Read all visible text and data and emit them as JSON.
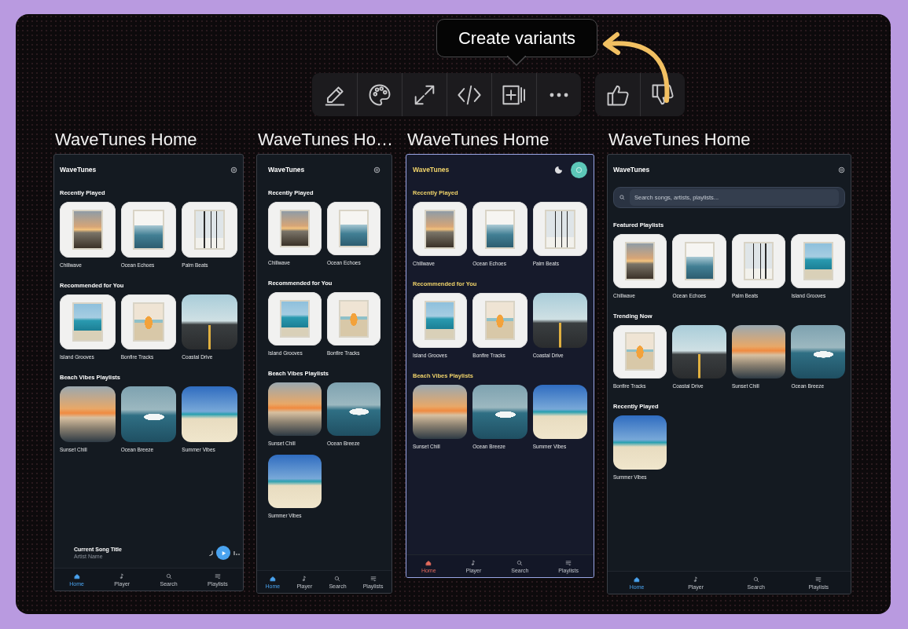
{
  "toolbar": {
    "tooltip": "Create variants",
    "tools": [
      {
        "kind": "edit"
      },
      {
        "kind": "palette"
      },
      {
        "kind": "expand"
      },
      {
        "kind": "code"
      },
      {
        "kind": "add-variant"
      },
      {
        "kind": "more"
      }
    ],
    "feedback": [
      {
        "kind": "like"
      },
      {
        "kind": "dislike"
      }
    ]
  },
  "variants": [
    {
      "title": "WaveTunes Home",
      "selected": false,
      "kind": "default",
      "app_name": "WaveTunes",
      "header_actions": [
        {
          "kind": "settings"
        }
      ],
      "sections": [
        {
          "heading": "Recently Played",
          "items": [
            {
              "title": "Chillwave",
              "kind": "sunset-poster"
            },
            {
              "title": "Ocean Echoes",
              "kind": "sea-poster"
            },
            {
              "title": "Palm Beats",
              "kind": "palm-poster"
            }
          ]
        },
        {
          "heading": "Recommended for You",
          "items": [
            {
              "title": "Island Grooves",
              "kind": "island-poster"
            },
            {
              "title": "Bonfire Tracks",
              "kind": "bonfire-poster"
            },
            {
              "title": "Coastal Drive",
              "kind": "road"
            }
          ]
        },
        {
          "heading": "Beach Vibes Playlists",
          "items": [
            {
              "title": "Sunset Chill",
              "kind": "sunset-beach"
            },
            {
              "title": "Ocean Breeze",
              "kind": "wave"
            },
            {
              "title": "Summer Vibes",
              "kind": "beach"
            }
          ]
        }
      ],
      "now_playing": {
        "title": "Current Song Title",
        "artist": "Artist Name"
      },
      "nav": [
        {
          "kind": "home",
          "label": "Home",
          "selected": true
        },
        {
          "kind": "player",
          "label": "Player",
          "selected": false
        },
        {
          "kind": "search",
          "label": "Search",
          "selected": false
        },
        {
          "kind": "playlists",
          "label": "Playlists",
          "selected": false
        }
      ]
    },
    {
      "title": "WaveTunes Ho…",
      "selected": false,
      "kind": "default",
      "app_name": "WaveTunes",
      "header_actions": [
        {
          "kind": "settings"
        }
      ],
      "sections": [
        {
          "heading": "Recently Played",
          "items": [
            {
              "title": "Chillwave",
              "kind": "sunset-poster"
            },
            {
              "title": "Ocean Echoes",
              "kind": "sea-poster"
            }
          ]
        },
        {
          "heading": "Recommended for You",
          "items": [
            {
              "title": "Island Grooves",
              "kind": "island-poster"
            },
            {
              "title": "Bonfire Tracks",
              "kind": "bonfire-poster"
            }
          ]
        },
        {
          "heading": "Beach Vibes Playlists",
          "items": [
            {
              "title": "Sunset Chill",
              "kind": "sunset-beach"
            },
            {
              "title": "Ocean Breeze",
              "kind": "wave"
            },
            {
              "title": "Summer Vibes",
              "kind": "beach"
            }
          ]
        }
      ],
      "nav": [
        {
          "kind": "home",
          "label": "Home",
          "selected": true
        },
        {
          "kind": "player",
          "label": "Player",
          "selected": false
        },
        {
          "kind": "search",
          "label": "Search",
          "selected": false
        },
        {
          "kind": "playlists",
          "label": "Playlists",
          "selected": false
        }
      ]
    },
    {
      "title": "WaveTunes Home",
      "selected": true,
      "kind": "gold",
      "app_name": "WaveTunes",
      "header_actions": [
        {
          "kind": "theme-toggle"
        },
        {
          "kind": "settings-button"
        }
      ],
      "sections": [
        {
          "heading": "Recently Played",
          "items": [
            {
              "title": "Chillwave",
              "kind": "sunset-poster"
            },
            {
              "title": "Ocean Echoes",
              "kind": "sea-poster"
            },
            {
              "title": "Palm Beats",
              "kind": "palm-poster"
            }
          ]
        },
        {
          "heading": "Recommended for You",
          "items": [
            {
              "title": "Island Grooves",
              "kind": "island-poster"
            },
            {
              "title": "Bonfire Tracks",
              "kind": "bonfire-poster"
            },
            {
              "title": "Coastal Drive",
              "kind": "road"
            }
          ]
        },
        {
          "heading": "Beach Vibes Playlists",
          "items": [
            {
              "title": "Sunset Chill",
              "kind": "sunset-beach"
            },
            {
              "title": "Ocean Breeze",
              "kind": "wave"
            },
            {
              "title": "Summer Vibes",
              "kind": "beach"
            }
          ]
        }
      ],
      "nav": [
        {
          "kind": "home",
          "label": "Home",
          "selected": true
        },
        {
          "kind": "player",
          "label": "Player",
          "selected": false
        },
        {
          "kind": "search",
          "label": "Search",
          "selected": false
        },
        {
          "kind": "playlists",
          "label": "Playlists",
          "selected": false
        }
      ]
    },
    {
      "title": "WaveTunes Home",
      "selected": false,
      "kind": "default",
      "app_name": "WaveTunes",
      "header_actions": [
        {
          "kind": "settings"
        }
      ],
      "search": {
        "placeholder": "Search songs, artists, playlists..."
      },
      "sections": [
        {
          "heading": "Featured Playlists",
          "items": [
            {
              "title": "Chillwave",
              "kind": "sunset-poster"
            },
            {
              "title": "Ocean Echoes",
              "kind": "sea-poster"
            },
            {
              "title": "Palm Beats",
              "kind": "palm-poster"
            },
            {
              "title": "Island Grooves",
              "kind": "island-poster"
            }
          ]
        },
        {
          "heading": "Trending Now",
          "items": [
            {
              "title": "Bonfire Tracks",
              "kind": "bonfire-poster"
            },
            {
              "title": "Coastal Drive",
              "kind": "road"
            },
            {
              "title": "Sunset Chill",
              "kind": "sunset-beach"
            },
            {
              "title": "Ocean Breeze",
              "kind": "wave"
            }
          ]
        },
        {
          "heading": "Recently Played",
          "items": [
            {
              "title": "Summer Vibes",
              "kind": "beach"
            }
          ]
        }
      ],
      "nav": [
        {
          "kind": "home",
          "label": "Home",
          "selected": true
        },
        {
          "kind": "player",
          "label": "Player",
          "selected": false
        },
        {
          "kind": "search",
          "label": "Search",
          "selected": false
        },
        {
          "kind": "playlists",
          "label": "Playlists",
          "selected": false
        }
      ]
    }
  ]
}
